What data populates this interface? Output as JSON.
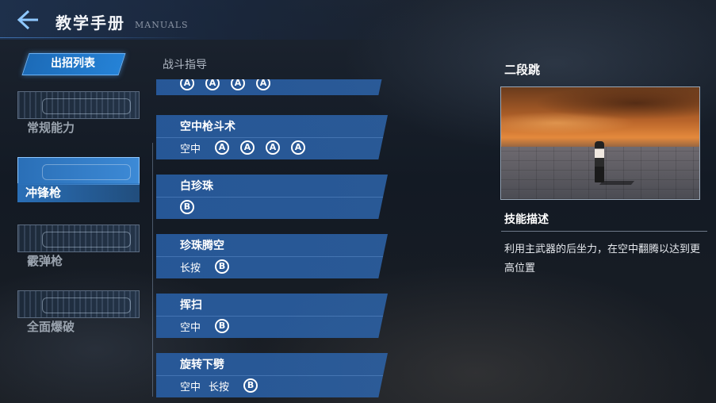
{
  "header": {
    "title": "教学手册",
    "subtitle": "MANUALS"
  },
  "tabs": {
    "active": "出招列表",
    "inactive": "战斗指导"
  },
  "weapons": [
    {
      "label": "常规能力",
      "selected": false
    },
    {
      "label": "冲锋枪",
      "selected": true
    },
    {
      "label": "霰弹枪",
      "selected": false
    },
    {
      "label": "全面爆破",
      "selected": false
    }
  ],
  "skills": [
    {
      "name": "",
      "inputs": [
        {
          "type": "btn",
          "v": "A"
        },
        {
          "type": "btn",
          "v": "A"
        },
        {
          "type": "btn",
          "v": "A"
        },
        {
          "type": "btn",
          "v": "A"
        }
      ]
    },
    {
      "name": "空中枪斗术",
      "inputs": [
        {
          "type": "txt",
          "v": "空中"
        },
        {
          "type": "btn",
          "v": "A"
        },
        {
          "type": "btn",
          "v": "A"
        },
        {
          "type": "btn",
          "v": "A"
        },
        {
          "type": "btn",
          "v": "A"
        }
      ]
    },
    {
      "name": "白珍珠",
      "inputs": [
        {
          "type": "btn",
          "v": "B"
        }
      ]
    },
    {
      "name": "珍珠腾空",
      "inputs": [
        {
          "type": "txt",
          "v": "长按"
        },
        {
          "type": "btn",
          "v": "B"
        }
      ]
    },
    {
      "name": "挥扫",
      "inputs": [
        {
          "type": "txt",
          "v": "空中"
        },
        {
          "type": "btn",
          "v": "B"
        }
      ]
    },
    {
      "name": "旋转下劈",
      "inputs": [
        {
          "type": "txt",
          "v": "空中"
        },
        {
          "type": "txt",
          "v": "长按"
        },
        {
          "type": "btn",
          "v": "B"
        }
      ]
    }
  ],
  "detail": {
    "title": "二段跳",
    "desc_label": "技能描述",
    "desc_text": "利用主武器的后坐力，在空中翻腾以达到更高位置"
  }
}
